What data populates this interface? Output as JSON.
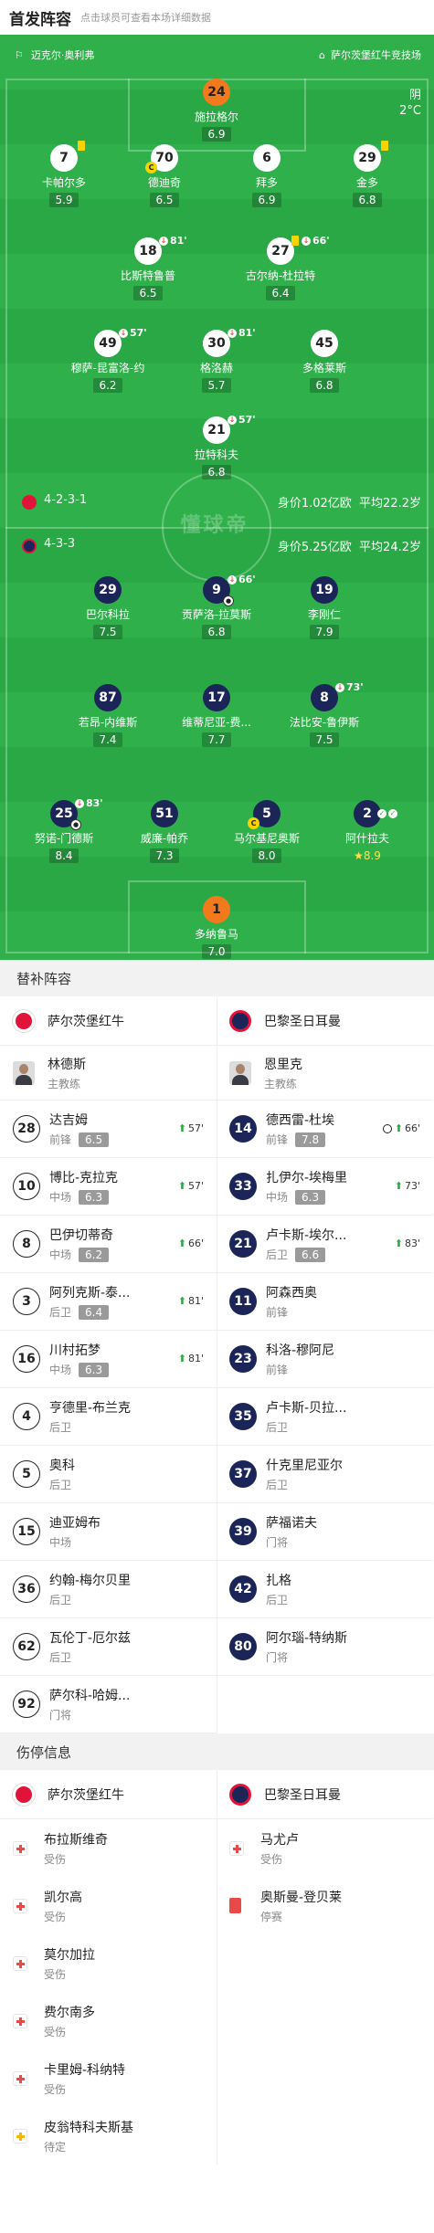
{
  "header": {
    "title": "首发阵容",
    "hint": "点击球员可查看本场详细数据"
  },
  "venue": {
    "left": "迈克尔·奥利弗",
    "right": "萨尔茨堡红牛竞技场"
  },
  "weather": {
    "condition": "阴",
    "temp": "2°C"
  },
  "home": {
    "formation": "4-2-3-1",
    "value": "身价1.02亿欧",
    "age": "平均22.2岁",
    "players": [
      {
        "num": "24",
        "name": "施拉格尔",
        "rating": "6.9"
      },
      {
        "num": "7",
        "name": "卡帕尔多",
        "rating": "5.9"
      },
      {
        "num": "70",
        "name": "德迪奇",
        "rating": "6.5"
      },
      {
        "num": "6",
        "name": "拜多",
        "rating": "6.9"
      },
      {
        "num": "29",
        "name": "金多",
        "rating": "6.8"
      },
      {
        "num": "18",
        "name": "比斯特鲁普",
        "rating": "6.5",
        "sub": "81'"
      },
      {
        "num": "27",
        "name": "古尔纳-杜拉特",
        "rating": "6.4",
        "sub": "66'"
      },
      {
        "num": "49",
        "name": "穆萨-昆富洛-约",
        "rating": "6.2",
        "sub": "57'"
      },
      {
        "num": "30",
        "name": "格洛赫",
        "rating": "5.7",
        "sub": "81'"
      },
      {
        "num": "45",
        "name": "多格莱斯",
        "rating": "6.8"
      },
      {
        "num": "21",
        "name": "拉特科夫",
        "rating": "6.8",
        "sub": "57'"
      }
    ]
  },
  "away": {
    "formation": "4-3-3",
    "value": "身价5.25亿欧",
    "age": "平均24.2岁",
    "players": [
      {
        "num": "29",
        "name": "巴尔科拉",
        "rating": "7.5"
      },
      {
        "num": "9",
        "name": "贡萨洛-拉莫斯",
        "rating": "6.8",
        "sub": "66'"
      },
      {
        "num": "19",
        "name": "李刚仁",
        "rating": "7.9"
      },
      {
        "num": "87",
        "name": "若昂-内维斯",
        "rating": "7.4"
      },
      {
        "num": "17",
        "name": "维蒂尼亚-费...",
        "rating": "7.7"
      },
      {
        "num": "8",
        "name": "法比安-鲁伊斯",
        "rating": "7.5",
        "sub": "73'"
      },
      {
        "num": "25",
        "name": "努诺-门德斯",
        "rating": "8.4",
        "sub": "83'"
      },
      {
        "num": "51",
        "name": "威廉-帕乔",
        "rating": "7.3"
      },
      {
        "num": "5",
        "name": "马尔基尼奥斯",
        "rating": "8.0"
      },
      {
        "num": "2",
        "name": "阿什拉夫",
        "rating": "8.9"
      },
      {
        "num": "1",
        "name": "多纳鲁马",
        "rating": "7.0"
      }
    ]
  },
  "watermark": "懂球帝",
  "subs": {
    "title": "替补阵容",
    "home_team": "萨尔茨堡红牛",
    "away_team": "巴黎圣日耳曼",
    "home_coach": {
      "name": "林德斯",
      "role": "主教练"
    },
    "away_coach": {
      "name": "恩里克",
      "role": "主教练"
    },
    "home": [
      {
        "num": "28",
        "name": "达吉姆",
        "pos": "前锋",
        "rating": "6.5",
        "time": "57'"
      },
      {
        "num": "10",
        "name": "博比-克拉克",
        "pos": "中场",
        "rating": "6.3",
        "time": "57'"
      },
      {
        "num": "8",
        "name": "巴伊切蒂奇",
        "pos": "中场",
        "rating": "6.2",
        "time": "66'"
      },
      {
        "num": "3",
        "name": "阿列克斯-泰...",
        "pos": "后卫",
        "rating": "6.4",
        "time": "81'"
      },
      {
        "num": "16",
        "name": "川村拓梦",
        "pos": "中场",
        "rating": "6.3",
        "time": "81'"
      },
      {
        "num": "4",
        "name": "亨德里-布兰克",
        "pos": "后卫"
      },
      {
        "num": "5",
        "name": "奥科",
        "pos": "后卫"
      },
      {
        "num": "15",
        "name": "迪亚姆布",
        "pos": "中场"
      },
      {
        "num": "36",
        "name": "约翰-梅尔贝里",
        "pos": "后卫"
      },
      {
        "num": "62",
        "name": "瓦伦丁-厄尔兹",
        "pos": "后卫"
      },
      {
        "num": "92",
        "name": "萨尔科-哈姆...",
        "pos": "门将"
      }
    ],
    "away": [
      {
        "num": "14",
        "name": "德西雷-杜埃",
        "pos": "前锋",
        "rating": "7.8",
        "time": "66'"
      },
      {
        "num": "33",
        "name": "扎伊尔-埃梅里",
        "pos": "中场",
        "rating": "6.3",
        "time": "73'"
      },
      {
        "num": "21",
        "name": "卢卡斯-埃尔...",
        "pos": "后卫",
        "rating": "6.6",
        "time": "83'"
      },
      {
        "num": "11",
        "name": "阿森西奥",
        "pos": "前锋"
      },
      {
        "num": "23",
        "name": "科洛-穆阿尼",
        "pos": "前锋"
      },
      {
        "num": "35",
        "name": "卢卡斯-贝拉...",
        "pos": "后卫"
      },
      {
        "num": "37",
        "name": "什克里尼亚尔",
        "pos": "后卫"
      },
      {
        "num": "39",
        "name": "萨福诺夫",
        "pos": "门将"
      },
      {
        "num": "42",
        "name": "扎格",
        "pos": "后卫"
      },
      {
        "num": "80",
        "name": "阿尔瑙-特纳斯",
        "pos": "门将"
      }
    ]
  },
  "injuries": {
    "title": "伤停信息",
    "home": [
      {
        "name": "布拉斯维奇",
        "status": "受伤"
      },
      {
        "name": "凯尔高",
        "status": "受伤"
      },
      {
        "name": "莫尔加拉",
        "status": "受伤"
      },
      {
        "name": "费尔南多",
        "status": "受伤"
      },
      {
        "name": "卡里姆-科纳特",
        "status": "受伤"
      },
      {
        "name": "皮翁特科夫斯基",
        "status": "待定"
      }
    ],
    "away": [
      {
        "name": "马尤卢",
        "status": "受伤"
      },
      {
        "name": "奥斯曼-登贝莱",
        "status": "停赛"
      }
    ]
  },
  "colors": {
    "pitch": "#2aa845",
    "home_jersey": "#ffffff",
    "away_jersey": "#1c2557",
    "gk_jersey": "#f07a1c"
  }
}
